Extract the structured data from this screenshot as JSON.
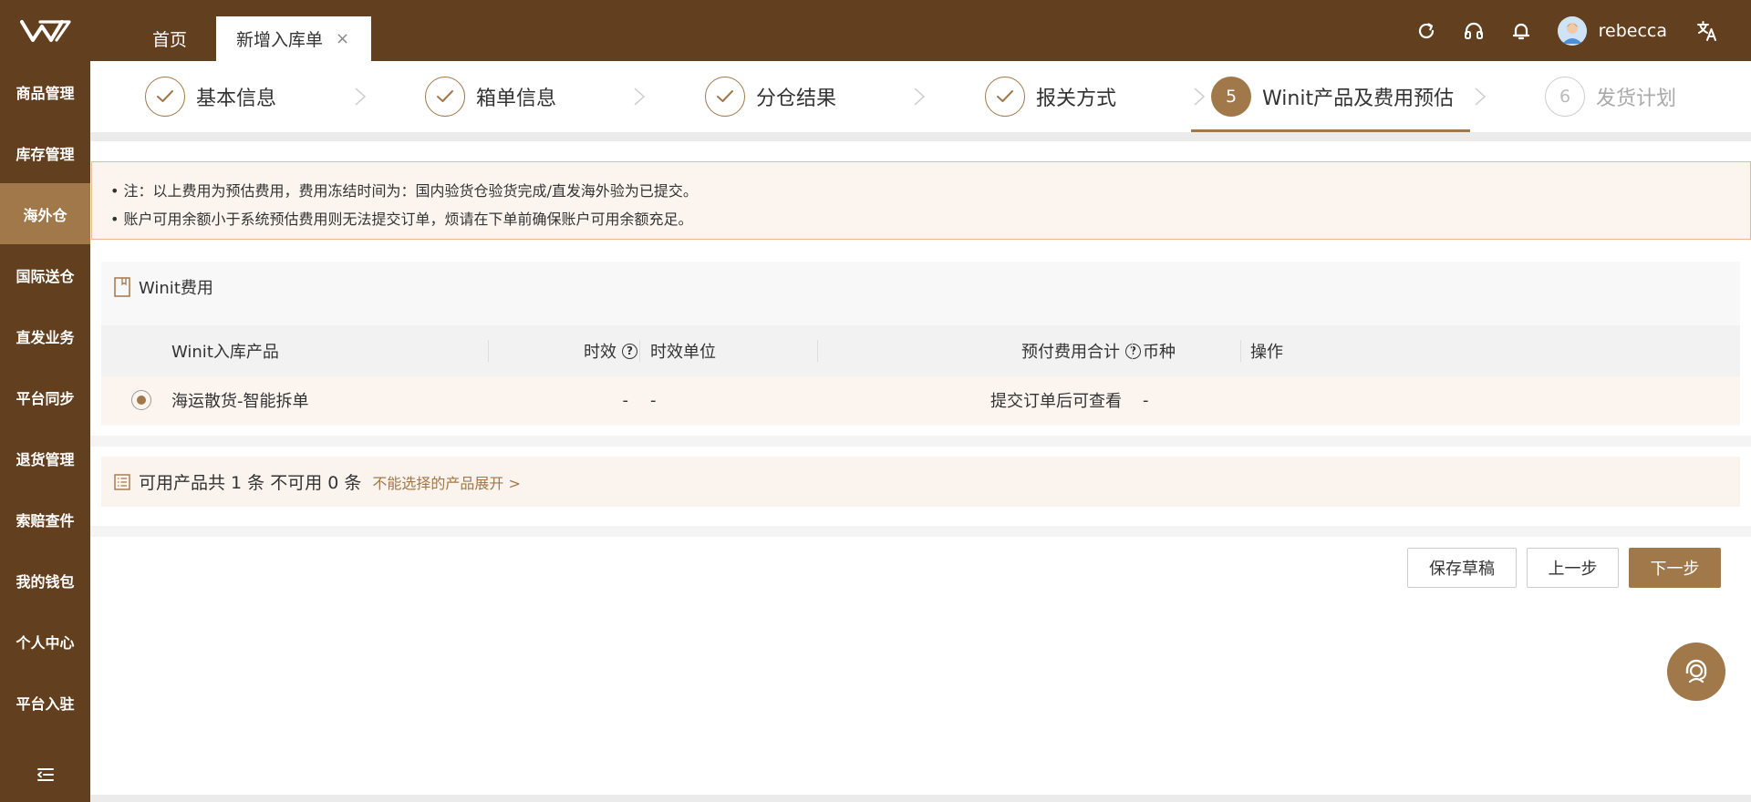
{
  "header": {
    "tabs": [
      {
        "label": "首页"
      },
      {
        "label": "新增入库单",
        "close": "×"
      }
    ],
    "user": {
      "name": "rebecca"
    }
  },
  "sidebar": {
    "items": [
      {
        "label": "商品管理"
      },
      {
        "label": "库存管理"
      },
      {
        "label": "海外仓",
        "active": true
      },
      {
        "label": "国际送仓"
      },
      {
        "label": "直发业务"
      },
      {
        "label": "平台同步"
      },
      {
        "label": "退货管理"
      },
      {
        "label": "索赔查件"
      },
      {
        "label": "我的钱包"
      },
      {
        "label": "个人中心"
      },
      {
        "label": "平台入驻"
      }
    ]
  },
  "steps": [
    {
      "label": "基本信息",
      "status": "done"
    },
    {
      "label": "箱单信息",
      "status": "done"
    },
    {
      "label": "分仓结果",
      "status": "done"
    },
    {
      "label": "报关方式",
      "status": "done"
    },
    {
      "num": "5",
      "label": "Winit产品及费用预估",
      "status": "current"
    },
    {
      "num": "6",
      "label": "发货计划",
      "status": "pending"
    }
  ],
  "notice": {
    "line1": "• 注：以上费用为预估费用，费用冻结时间为：国内验货仓验货完成/直发海外验为已提交。",
    "line2": "• 账户可用余额小于系统预估费用则无法提交订单，烦请在下单前确保账户可用余额充足。"
  },
  "fee_card": {
    "title": "Winit费用",
    "columns": {
      "product": "Winit入库产品",
      "timeliness": "时效",
      "time_unit": "时效单位",
      "prepaid_total": "预付费用合计",
      "currency": "币种",
      "action": "操作"
    },
    "rows": [
      {
        "product": "海运散货-智能拆单",
        "timeliness": "-",
        "time_unit": "-",
        "prepaid_total": "提交订单后可查看",
        "currency": "-",
        "action": ""
      }
    ]
  },
  "summary": {
    "text": "可用产品共 1 条 不可用 0 条",
    "link": "不能选择的产品展开 >"
  },
  "buttons": {
    "save_draft": "保存草稿",
    "prev": "上一步",
    "next": "下一步"
  },
  "colors": {
    "header_bg": "#623f1e",
    "accent": "#a0784a",
    "notice_bg": "#fcf5ef",
    "notice_border": "#e7b896"
  }
}
